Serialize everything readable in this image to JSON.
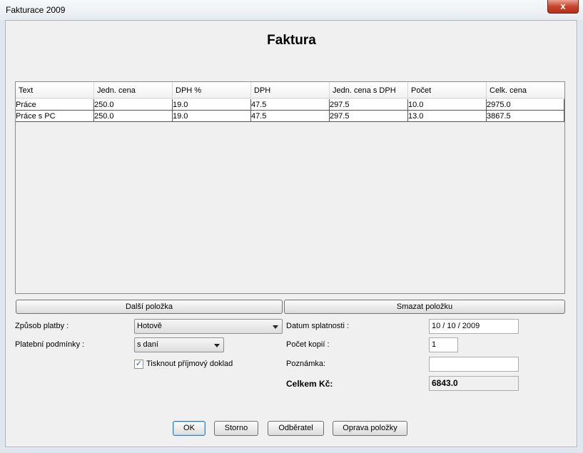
{
  "window": {
    "title": "Fakturace 2009",
    "close_glyph": "x"
  },
  "heading": "Faktura",
  "table": {
    "columns": [
      "Text",
      "Jedn. cena",
      "DPH %",
      "DPH",
      "Jedn. cena s DPH",
      "Počet",
      "Celk. cena"
    ],
    "rows": [
      [
        "Práce",
        "250.0",
        "19.0",
        "47.5",
        "297.5",
        "10.0",
        "2975.0"
      ],
      [
        "Práce s PC",
        "250.0",
        "19.0",
        "47.5",
        "297.5",
        "13.0",
        "3867.5"
      ]
    ]
  },
  "buttons": {
    "next_item": "Další položka",
    "delete_item": "Smazat položku",
    "ok": "OK",
    "cancel": "Storno",
    "customer": "Odběratel",
    "edit_item": "Oprava položky"
  },
  "form": {
    "payment_method_label": "Způsob platby :",
    "payment_method_value": "Hotově",
    "payment_terms_label": "Platební podmínky :",
    "payment_terms_value": "s daní",
    "print_receipt_label": "Tisknout příjmový doklad",
    "print_receipt_checked": true,
    "due_date_label": "Datum splatnosti :",
    "due_date_value": "10 / 10 / 2009",
    "copies_label": "Počet kopií :",
    "copies_value": "1",
    "note_label": "Poznámka:",
    "note_value": "",
    "total_label": "Celkem Kč:",
    "total_value": "6843.0"
  }
}
